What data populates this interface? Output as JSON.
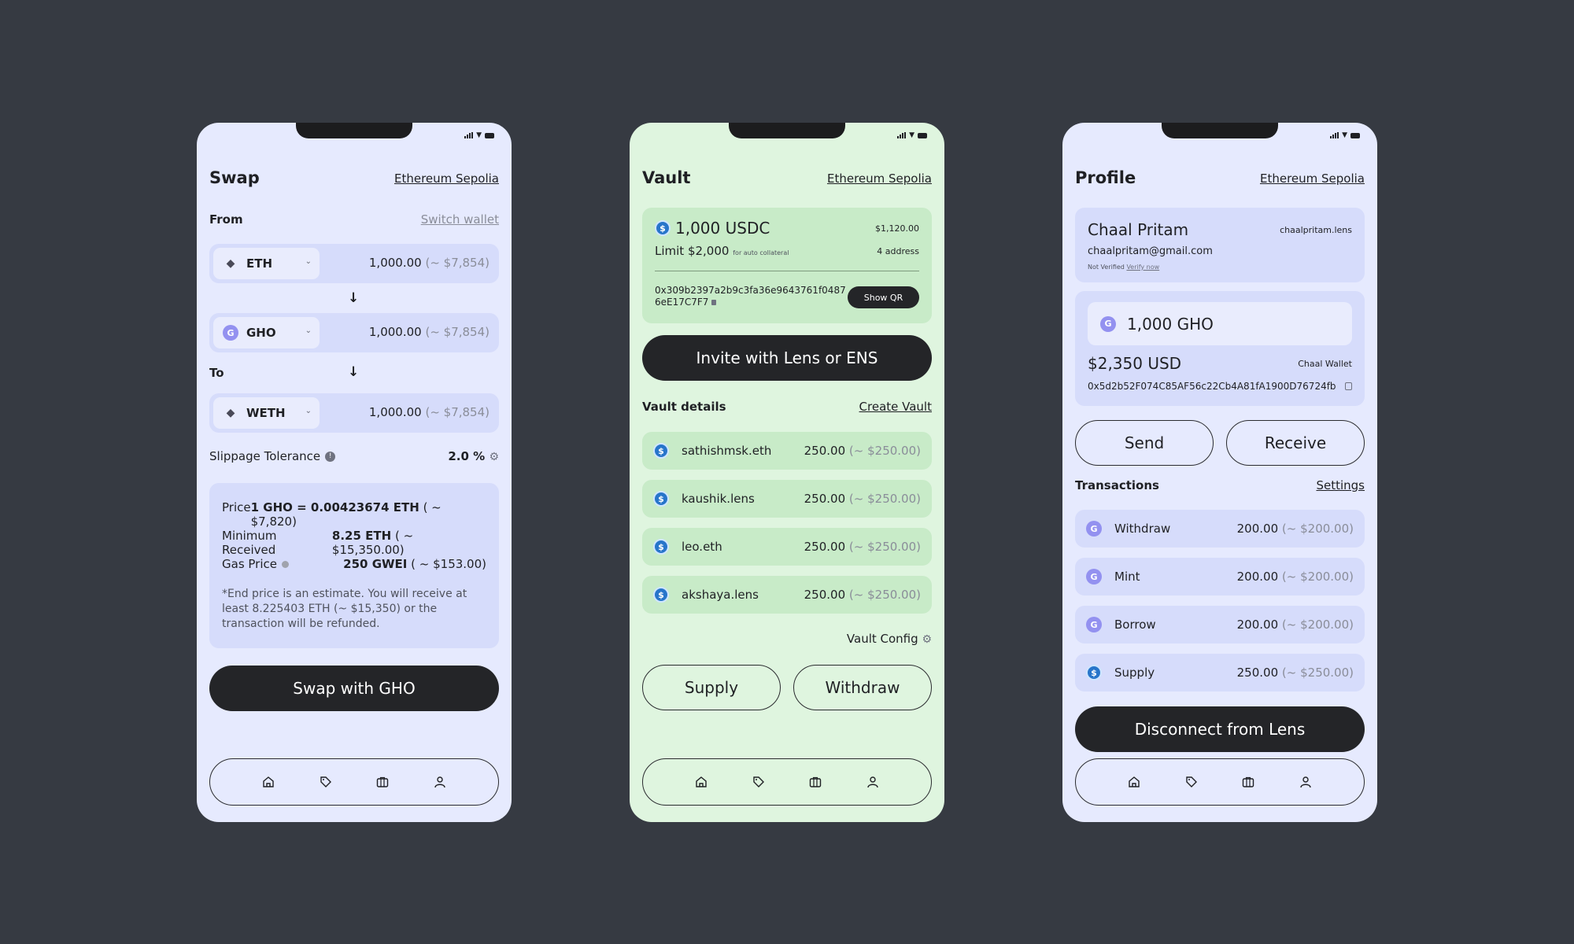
{
  "swap": {
    "title": "Swap",
    "network": "Ethereum Sepolia",
    "from_label": "From",
    "switch_wallet": "Switch wallet",
    "to_label": "To",
    "tokens": [
      {
        "symbol": "ETH",
        "amount": "1,000.00",
        "usd": "(~ $7,854)"
      },
      {
        "symbol": "GHO",
        "amount": "1,000.00",
        "usd": "(~ $7,854)"
      },
      {
        "symbol": "WETH",
        "amount": "1,000.00",
        "usd": "(~ $7,854)"
      }
    ],
    "slippage_label": "Slippage Tolerance",
    "slippage_value": "2.0 %",
    "price_label": "Price",
    "price_value": "1 GHO = 0.00423674 ETH",
    "price_usd": "( ~ $7,820)",
    "min_label": "Minimum Received",
    "min_value": "8.25 ETH",
    "min_usd": "( ~ $15,350.00)",
    "gas_label": "Gas Price",
    "gas_value": "250 GWEI",
    "gas_usd": "( ~ $153.00)",
    "note": "*End price is an estimate. You will receive at least 8.225403 ETH (~ $15,350) or the transaction will be refunded.",
    "cta": "Swap with GHO"
  },
  "vault": {
    "title": "Vault",
    "network": "Ethereum Sepolia",
    "balance": "1,000 USDC",
    "balance_usd": "$1,120.00",
    "limit": "Limit $2,000",
    "limit_note": "for auto collateral",
    "address_count": "4 address",
    "address_line1": "0x309b2397a2b9c3fa36e9643761f0487",
    "address_line2": "6eE17C7F7",
    "show_qr": "Show QR",
    "invite": "Invite with Lens or ENS",
    "details_label": "Vault details",
    "create_vault": "Create Vault",
    "members": [
      {
        "name": "sathishmsk.eth",
        "amount": "250.00",
        "usd": "(~ $250.00)"
      },
      {
        "name": "kaushik.lens",
        "amount": "250.00",
        "usd": "(~ $250.00)"
      },
      {
        "name": "leo.eth",
        "amount": "250.00",
        "usd": "(~ $250.00)"
      },
      {
        "name": "akshaya.lens",
        "amount": "250.00",
        "usd": "(~ $250.00)"
      }
    ],
    "config": "Vault Config",
    "supply": "Supply",
    "withdraw": "Withdraw"
  },
  "profile": {
    "title": "Profile",
    "network": "Ethereum Sepolia",
    "name": "Chaal Pritam",
    "handle": "chaalpritam.lens",
    "email": "chaalpritam@gmail.com",
    "not_verified": "Not Verified",
    "verify_now": "Verify now",
    "gho_balance": "1,000 GHO",
    "usd_balance": "$2,350 USD",
    "wallet_label": "Chaal Wallet",
    "wallet_address": "0x5d2b52F074C85AF56c22Cb4A81fA1900D76724fb",
    "send": "Send",
    "receive": "Receive",
    "transactions_label": "Transactions",
    "settings": "Settings",
    "transactions": [
      {
        "name": "Withdraw",
        "amount": "200.00",
        "usd": "(~ $200.00)",
        "icon": "gho-coin-icon"
      },
      {
        "name": "Mint",
        "amount": "200.00",
        "usd": "(~ $200.00)",
        "icon": "gho-coin-icon"
      },
      {
        "name": "Borrow",
        "amount": "200.00",
        "usd": "(~ $200.00)",
        "icon": "gho-coin-icon"
      },
      {
        "name": "Supply",
        "amount": "250.00",
        "usd": "(~ $250.00)",
        "icon": "usdc-coin-icon"
      }
    ],
    "disconnect": "Disconnect from Lens"
  },
  "colors": {
    "background": "#363a42",
    "swap_bg": "#e6eafe",
    "vault_bg": "#dff5df",
    "dark_button": "#242528"
  }
}
